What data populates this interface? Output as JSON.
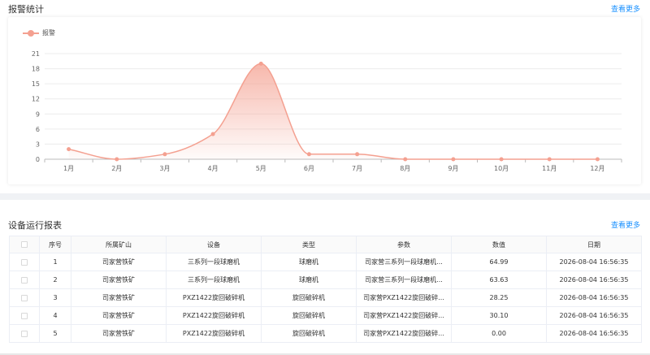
{
  "alarm": {
    "title": "报警统计",
    "more": "查看更多"
  },
  "chart_data": {
    "type": "area",
    "title": "",
    "categories": [
      "1月",
      "2月",
      "3月",
      "4月",
      "5月",
      "6月",
      "7月",
      "8月",
      "9月",
      "10月",
      "11月",
      "12月"
    ],
    "series": [
      {
        "name": "报警",
        "values": [
          2,
          0,
          1,
          5,
          19,
          1,
          1,
          0,
          0,
          0,
          0,
          0
        ]
      }
    ],
    "y_ticks": [
      "0",
      "3",
      "6",
      "9",
      "12",
      "15",
      "18",
      "21"
    ],
    "ylim": [
      0,
      21
    ],
    "grid": true,
    "legend": "top-left",
    "color": "#f4a090"
  },
  "report": {
    "title": "设备运行报表",
    "more": "查看更多",
    "columns": [
      "序号",
      "所属矿山",
      "设备",
      "类型",
      "参数",
      "数值",
      "日期"
    ],
    "rows": [
      [
        "1",
        "司家营铁矿",
        "三系列一段球磨机",
        "球磨机",
        "司家营三系列一段球磨机...",
        "64.99",
        "2026-08-04 16:56:35"
      ],
      [
        "2",
        "司家营铁矿",
        "三系列一段球磨机",
        "球磨机",
        "司家营三系列一段球磨机...",
        "63.63",
        "2026-08-04 16:56:35"
      ],
      [
        "3",
        "司家营铁矿",
        "PXZ1422旋回破碎机",
        "旋回破碎机",
        "司家营PXZ1422旋回破碎...",
        "28.25",
        "2026-08-04 16:56:35"
      ],
      [
        "4",
        "司家营铁矿",
        "PXZ1422旋回破碎机",
        "旋回破碎机",
        "司家营PXZ1422旋回破碎...",
        "30.10",
        "2026-08-04 16:56:35"
      ],
      [
        "5",
        "司家营铁矿",
        "PXZ1422旋回破碎机",
        "旋回破碎机",
        "司家营PXZ1422旋回破碎...",
        "0.00",
        "2026-08-04 16:56:35"
      ]
    ]
  }
}
